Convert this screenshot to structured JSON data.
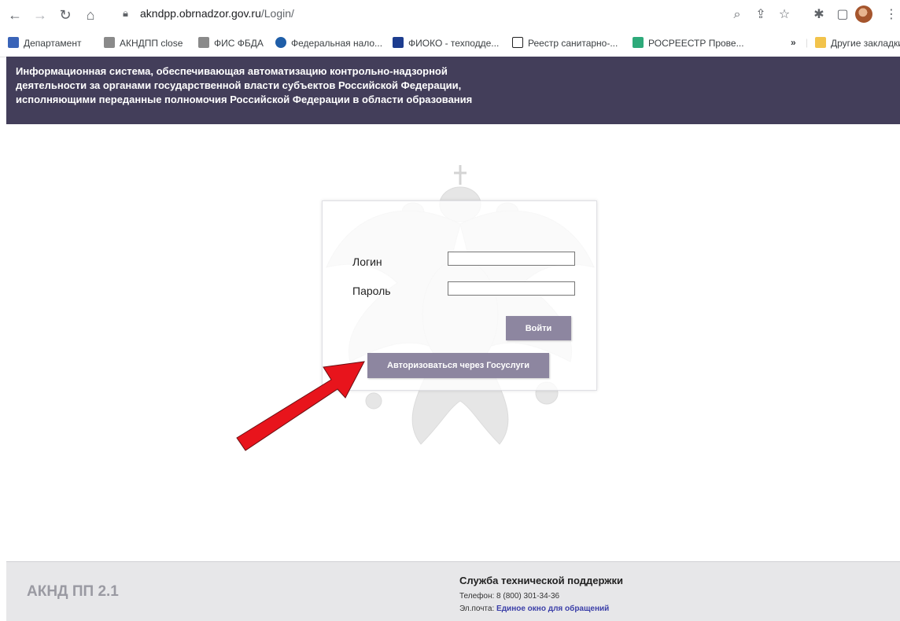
{
  "browser": {
    "url_host": "akndpp.obrnadzor.gov.ru",
    "url_path": "/Login/",
    "bookmarks": [
      {
        "label": "Департамент",
        "color": "#3a64b8"
      },
      {
        "label": "АКНДПП close",
        "color": "#6b6b6b"
      },
      {
        "label": "ФИС ФБДА",
        "color": "#6b6b6b"
      },
      {
        "label": "Федеральная нало...",
        "color": "#1f5ea8"
      },
      {
        "label": "ФИОКО - техподде...",
        "color": "#1d3d8f"
      },
      {
        "label": "Реестр санитарно-...",
        "color": "#222222"
      },
      {
        "label": "РОСРЕЕСТР Прове...",
        "color": "#2eaa7a"
      }
    ],
    "overflow": "»",
    "other_bookmarks": "Другие закладки"
  },
  "header": {
    "title": "Информационная система, обеспечивающая автоматизацию контрольно-надзорной\nдеятельности за органами государственной власти субъектов Российской Федерации,\nисполняющими переданные полномочия Российской Федерации в области образования"
  },
  "login": {
    "login_label": "Логин",
    "password_label": "Пароль",
    "login_value": "",
    "password_value": "",
    "submit_label": "Войти",
    "gosuslugi_label": "Авторизоваться через Госуслуги"
  },
  "footer": {
    "brand": "АКНД ПП 2.1",
    "support_title": "Служба технической поддержки",
    "phone_label": "Телефон:",
    "phone_value": "8 (800) 301-34-36",
    "email_label": "Эл.почта:",
    "email_link": "Единое окно для обращений"
  },
  "colors": {
    "header_bg": "#433e5a",
    "button_bg": "#8d86a0",
    "arrow": "#e8141c"
  }
}
